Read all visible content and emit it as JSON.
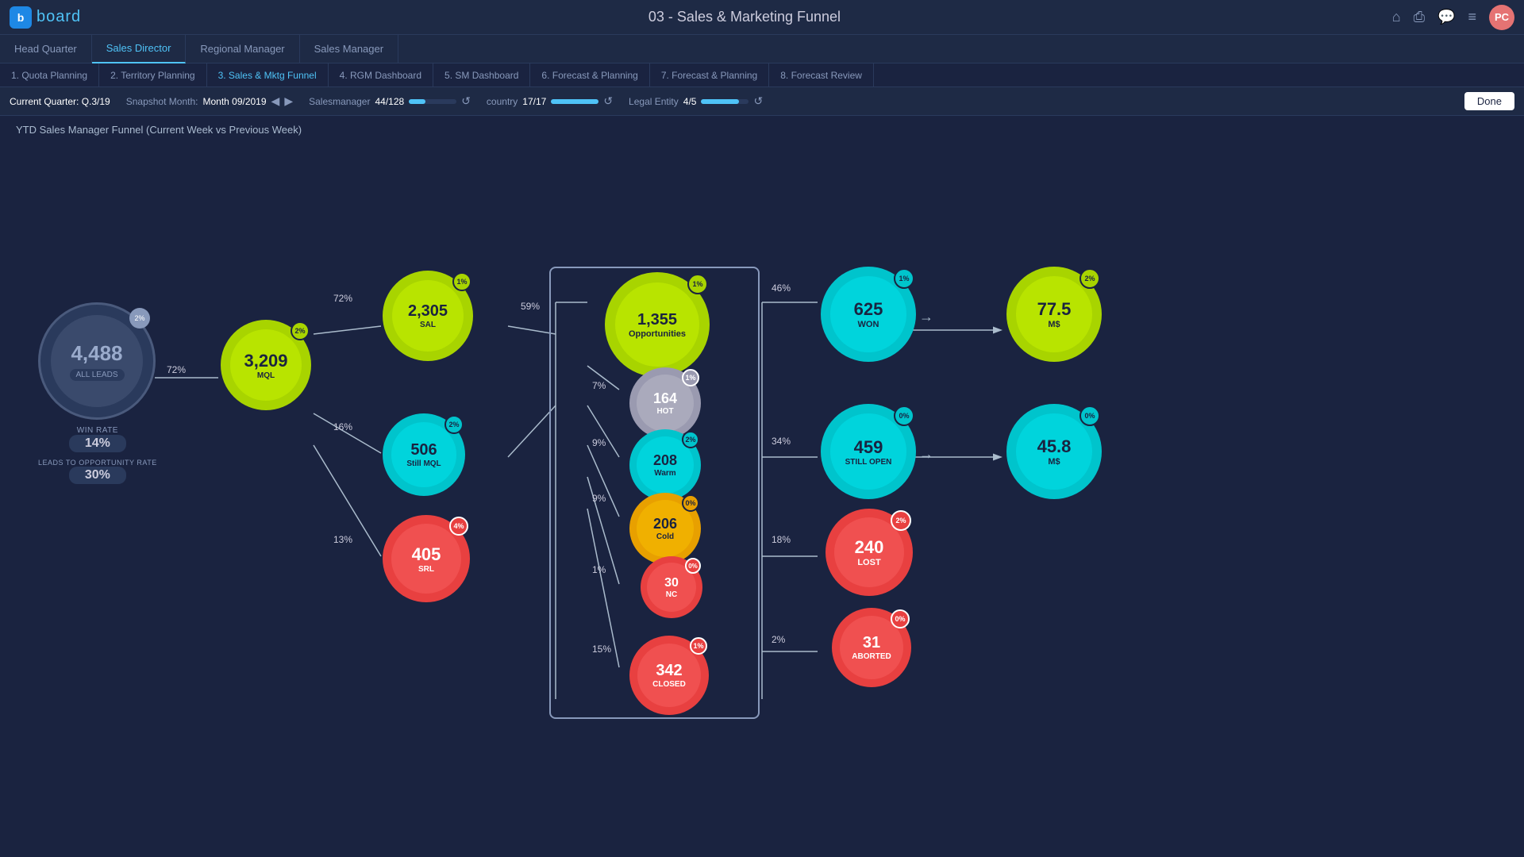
{
  "app": {
    "logo_letter": "b",
    "logo_name": "board",
    "page_title": "03 - Sales & Marketing Funnel",
    "avatar": "PC"
  },
  "nav": {
    "tabs": [
      {
        "label": "Head Quarter",
        "active": false
      },
      {
        "label": "Sales Director",
        "active": true
      },
      {
        "label": "Regional Manager",
        "active": false
      },
      {
        "label": "Sales Manager",
        "active": false
      }
    ],
    "sub_items": [
      {
        "label": "1. Quota Planning",
        "active": false
      },
      {
        "label": "2. Territory Planning",
        "active": false
      },
      {
        "label": "3. Sales & Mktg Funnel",
        "active": true
      },
      {
        "label": "4. RGM Dashboard",
        "active": false
      },
      {
        "label": "5. SM Dashboard",
        "active": false
      },
      {
        "label": "6. Forecast & Planning",
        "active": false
      },
      {
        "label": "7. Forecast & Planning",
        "active": false
      },
      {
        "label": "8. Forecast Review",
        "active": false
      }
    ]
  },
  "filters": {
    "quarter_label": "Current Quarter: Q.3/19",
    "snapshot_label": "Snapshot Month:",
    "snapshot_value": "Month 09/2019",
    "salesmanager_label": "Salesmanager",
    "salesmanager_value": "44/128",
    "salesmanager_pct": 34,
    "country_label": "country",
    "country_value": "17/17",
    "country_pct": 100,
    "legal_label": "Legal Entity",
    "legal_value": "4/5",
    "legal_pct": 80,
    "done_label": "Done"
  },
  "chart": {
    "title": "YTD Sales Manager Funnel (Current Week vs Previous Week)",
    "nodes": {
      "all_leads": {
        "value": "4,488",
        "label": "ALL LEADS",
        "badge": "2%"
      },
      "mql": {
        "value": "3,209",
        "label": "MQL",
        "badge": "2%"
      },
      "sal": {
        "value": "2,305",
        "label": "SAL",
        "badge": "1%"
      },
      "still_mql": {
        "value": "506",
        "label": "Still MQL",
        "badge": "2%"
      },
      "srl": {
        "value": "405",
        "label": "SRL",
        "badge": "4%"
      },
      "opportunities": {
        "value": "1,355",
        "label": "Opportunities",
        "badge": "1%"
      },
      "hot": {
        "value": "164",
        "label": "HOT",
        "badge": "1%"
      },
      "warm": {
        "value": "208",
        "label": "Warm",
        "badge": "2%"
      },
      "cold": {
        "value": "206",
        "label": "Cold",
        "badge": "0%"
      },
      "nc": {
        "value": "30",
        "label": "NC",
        "badge": "0%"
      },
      "closed": {
        "value": "342",
        "label": "CLOSED",
        "badge": "1%"
      },
      "won": {
        "value": "625",
        "label": "WON",
        "badge": "1%"
      },
      "won_ms": {
        "value": "77.5",
        "label": "M$",
        "badge": "2%"
      },
      "still_open": {
        "value": "459",
        "label": "STILL OPEN",
        "badge": "0%"
      },
      "still_open_ms": {
        "value": "45.8",
        "label": "M$",
        "badge": "0%"
      },
      "lost": {
        "value": "240",
        "label": "LOST",
        "badge": "2%"
      },
      "aborted": {
        "value": "31",
        "label": "ABORTED",
        "badge": "0%"
      }
    },
    "percentages": {
      "mql_pct": "72%",
      "sal_pct": "72%",
      "still_mql_pct": "16%",
      "srl_pct": "13%",
      "opp_pct": "59%",
      "hot_pct": "7%",
      "warm_pct": "9%",
      "cold_pct": "9%",
      "nc_pct": "1%",
      "closed_pct": "15%",
      "won_pct": "46%",
      "still_open_pct": "34%",
      "lost_pct": "18%",
      "aborted_pct": "2%"
    },
    "metrics": {
      "win_rate_label": "WIN RATE",
      "win_rate_value": "14%",
      "leads_to_opp_label": "LEADS TO OPPORTUNITY RATE",
      "leads_to_opp_value": "30%"
    }
  }
}
